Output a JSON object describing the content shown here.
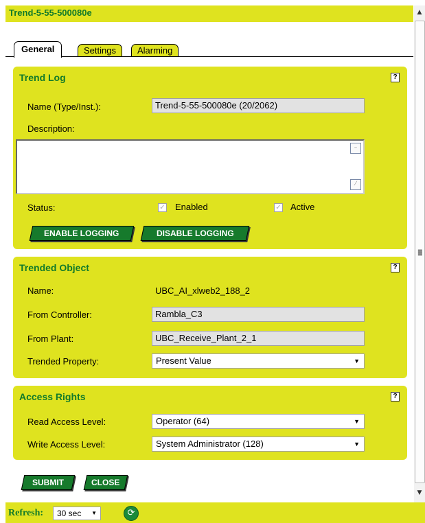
{
  "window": {
    "title": "Trend-5-55-500080e"
  },
  "tabs": [
    {
      "label": "General",
      "active": true
    },
    {
      "label": "Settings",
      "active": false
    },
    {
      "label": "Alarming",
      "active": false
    }
  ],
  "trend_log": {
    "title": "Trend Log",
    "help": "?",
    "name_label": "Name (Type/Inst.):",
    "name_value": "Trend-5-55-500080e (20/2062)",
    "description_label": "Description:",
    "description_value": "",
    "status_label": "Status:",
    "enabled_label": "Enabled",
    "enabled_checked": true,
    "active_label": "Active",
    "active_checked": true,
    "enable_button": "ENABLE LOGGING",
    "disable_button": "DISABLE LOGGING"
  },
  "trended_object": {
    "title": "Trended Object",
    "help": "?",
    "name_label": "Name:",
    "name_value": "UBC_AI_xlweb2_188_2",
    "controller_label": "From Controller:",
    "controller_value": "Rambla_C3",
    "plant_label": "From Plant:",
    "plant_value": "UBC_Receive_Plant_2_1",
    "property_label": "Trended Property:",
    "property_value": "Present Value"
  },
  "access_rights": {
    "title": "Access Rights",
    "help": "?",
    "read_label": "Read Access Level:",
    "read_value": "Operator (64)",
    "write_label": "Write Access Level:",
    "write_value": "System Administrator (128)"
  },
  "actions": {
    "submit": "SUBMIT",
    "close": "CLOSE"
  },
  "footer": {
    "refresh_label": "Refresh:",
    "refresh_value": "30 sec"
  },
  "colors": {
    "panel_bg": "#dfe31f",
    "title_green": "#117a2a",
    "button_green": "#167a2c"
  },
  "icons": {
    "help": "help-icon",
    "refresh": "refresh-icon",
    "dropdown": "chevron-down-icon"
  }
}
